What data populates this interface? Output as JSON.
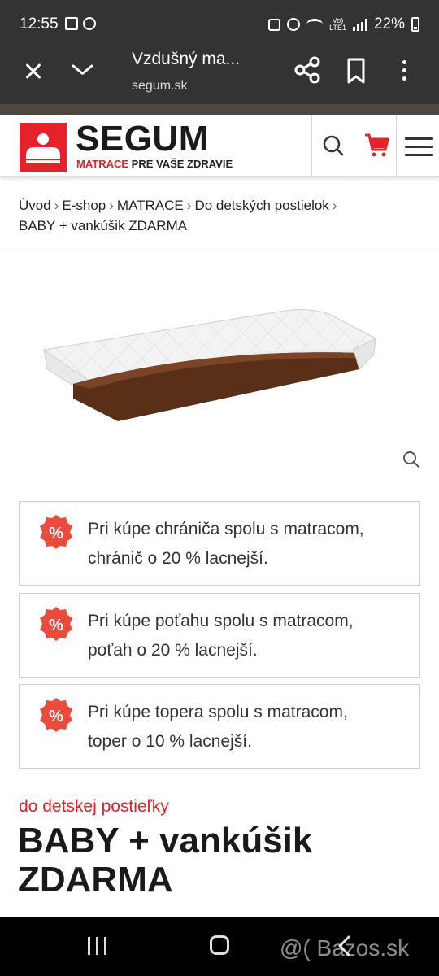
{
  "status_bar": {
    "time": "12:55",
    "battery_percent": "22%",
    "volte_label": "Vo)\nLTE1"
  },
  "browser": {
    "title": "Vzdušný ma...",
    "domain": "segum.sk"
  },
  "site": {
    "logo_text": "SEGUM",
    "tagline_red": "MATRACE",
    "tagline_dark": " PRE VAŠE ZDRAVIE"
  },
  "breadcrumb": {
    "items": [
      "Úvod",
      "E-shop",
      "MATRACE",
      "Do detských postielok",
      "BABY + vankúšik ZDARMA"
    ],
    "separator": "›"
  },
  "promos": [
    {
      "badge": "%",
      "line1": "Pri kúpe chrániča spolu s matracom,",
      "line2": "chránič o 20 % lacnejší."
    },
    {
      "badge": "%",
      "line1": "Pri kúpe poťahu spolu s matracom,",
      "line2": "poťah o 20 % lacnejší."
    },
    {
      "badge": "%",
      "line1": "Pri kúpe topera spolu s matracom,",
      "line2": "toper o 10 % lacnejší."
    }
  ],
  "product": {
    "category": "do detskej postieľky",
    "title_line1": "BABY + vankúšik",
    "title_line2": "ZDARMA"
  },
  "watermark": "@( Bazos.sk",
  "icons": {
    "close": "close-icon",
    "chevron": "chevron-down-icon",
    "share": "share-icon",
    "bookmark": "bookmark-icon",
    "more": "more-vert-icon",
    "search": "search-icon",
    "cart": "cart-icon",
    "menu": "hamburger-icon",
    "zoom": "zoom-icon"
  },
  "colors": {
    "brand_red": "#e32229",
    "browser_bar": "#333334",
    "strip_brown": "#4f4640"
  }
}
